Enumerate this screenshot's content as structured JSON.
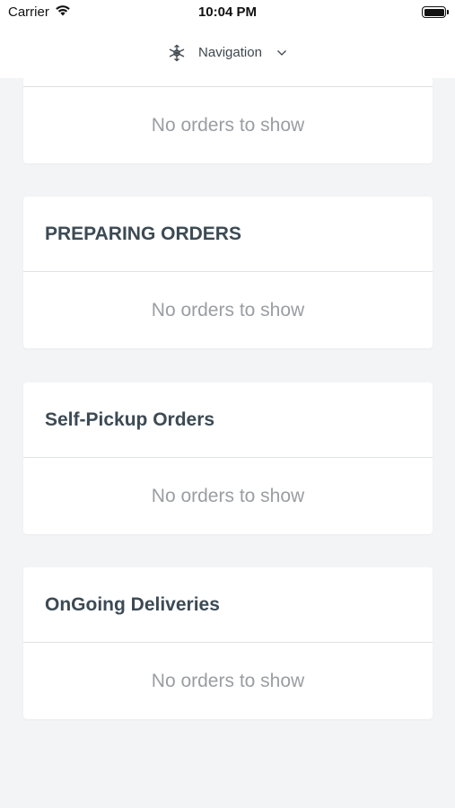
{
  "status_bar": {
    "carrier": "Carrier",
    "time": "10:04 PM"
  },
  "header": {
    "title": "Navigation"
  },
  "sections": [
    {
      "title": "",
      "empty_text": "No orders to show"
    },
    {
      "title": "PREPARING ORDERS",
      "empty_text": "No orders to show"
    },
    {
      "title": "Self-Pickup Orders",
      "empty_text": "No orders to show"
    },
    {
      "title": "OnGoing Deliveries",
      "empty_text": "No orders to show"
    }
  ],
  "icons": {
    "wifi": "wifi-icon",
    "battery": "battery-icon",
    "nav": "compass-icon",
    "dropdown": "chevron-down-icon"
  }
}
